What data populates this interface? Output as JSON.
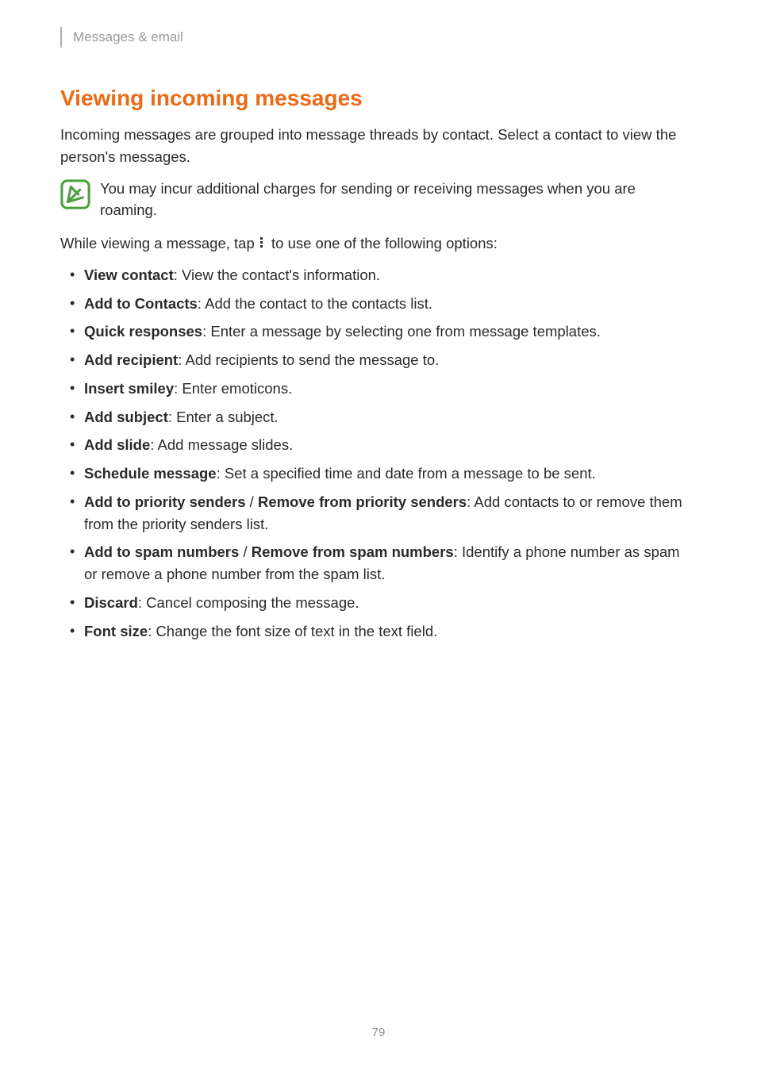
{
  "header": {
    "breadcrumb": "Messages & email"
  },
  "section": {
    "title": "Viewing incoming messages",
    "intro": "Incoming messages are grouped into message threads by contact. Select a contact to view the person's messages.",
    "note": "You may incur additional charges for sending or receiving messages when you are roaming.",
    "tap_line_pre": "While viewing a message, tap ",
    "tap_line_post": " to use one of the following options:",
    "options": [
      {
        "label": "View contact",
        "desc": ": View the contact's information."
      },
      {
        "label": "Add to Contacts",
        "desc": ": Add the contact to the contacts list."
      },
      {
        "label": "Quick responses",
        "desc": ": Enter a message by selecting one from message templates."
      },
      {
        "label": "Add recipient",
        "desc": ": Add recipients to send the message to."
      },
      {
        "label": "Insert smiley",
        "desc": ": Enter emoticons."
      },
      {
        "label": "Add subject",
        "desc": ": Enter a subject."
      },
      {
        "label": "Add slide",
        "desc": ": Add message slides."
      },
      {
        "label": "Schedule message",
        "desc": ": Set a specified time and date from a message to be sent."
      },
      {
        "label": "Add to priority senders",
        "label2": "Remove from priority senders",
        "desc": ": Add contacts to or remove them from the priority senders list."
      },
      {
        "label": "Add to spam numbers",
        "label2": "Remove from spam numbers",
        "desc": ": Identify a phone number as spam or remove a phone number from the spam list."
      },
      {
        "label": "Discard",
        "desc": ": Cancel composing the message."
      },
      {
        "label": "Font size",
        "desc": ": Change the font size of text in the text field."
      }
    ]
  },
  "page_number": "79"
}
